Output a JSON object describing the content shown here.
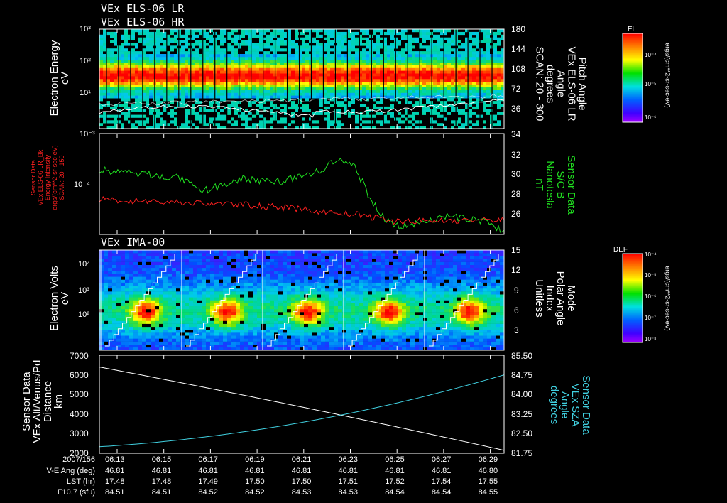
{
  "titles": {
    "p1_line1": "VEx ELS-06 LR",
    "p1_line2": "VEx ELS-06 HR",
    "p3": "VEx IMA-00"
  },
  "colors": {
    "background": "#000000",
    "axis": "#ffffff",
    "red_series": "#ff2020",
    "green_series": "#20e020",
    "sza_series": "#40d0e0",
    "alt_series": "#ffffff"
  },
  "colorbars": {
    "els": {
      "title": "El",
      "ticks": [
        "10⁻⁴",
        "10⁻⁵",
        "10⁻⁶"
      ],
      "unit": "ergs/(cm**2-sr-sec-eV)"
    },
    "ima": {
      "title": "DEF",
      "ticks": [
        "10⁻⁴",
        "10⁻⁵",
        "10⁻⁶",
        "10⁻⁷",
        "10⁻⁸"
      ],
      "unit": "ergs/(cm**2-sr-sec-eV)"
    }
  },
  "chart_data": [
    {
      "type": "heatmap",
      "name_ref": "els_spectrogram",
      "ylabel_lines": [
        "Electron Energy",
        "eV"
      ],
      "yscale": "log",
      "ylim": [
        1,
        1000
      ],
      "yticks": [
        "10⁰",
        "10¹",
        "10²",
        "10³"
      ],
      "right_axis": {
        "label_lines": [
          "Pitch Angle",
          "VEx ELS-06 LR",
          "Angle",
          "degrees",
          "SCAN: 20 - 300"
        ],
        "ylim": [
          0,
          180
        ],
        "ticks": [
          "36",
          "72",
          "108",
          "144",
          "180"
        ]
      },
      "peak_energy_eV": 40
    },
    {
      "type": "line",
      "name_ref": "energy_intensity_and_b",
      "left_axis": {
        "label_lines": [
          "Sensor Data",
          "VEx ELS-06 LR_Bk",
          "Energy Intensity",
          "ergs/(cm**2-sr-sec-eV)",
          "SCAN: 20 - 150"
        ],
        "yscale": "log",
        "ticks": [
          "10⁻³",
          "10⁻⁴"
        ]
      },
      "right_axis": {
        "label_lines": [
          "Sensor Data",
          "S/C B",
          "Nanotesla",
          "nT"
        ],
        "ylim": [
          24.5,
          34
        ],
        "ticks": [
          "26",
          "28",
          "30",
          "32",
          "34"
        ]
      },
      "series": [
        {
          "name": "Energy Intensity",
          "anchors_log10": [
            [
              0,
              -3.95
            ],
            [
              0.35,
              -4.02
            ],
            [
              0.45,
              -4.06
            ],
            [
              0.6,
              -4.15
            ],
            [
              0.65,
              -4.17
            ],
            [
              0.72,
              -4.26
            ],
            [
              1,
              -4.24
            ]
          ]
        },
        {
          "name": "S/C B",
          "anchors_nT": [
            [
              0,
              30.6
            ],
            [
              0.1,
              30.2
            ],
            [
              0.2,
              29.8
            ],
            [
              0.25,
              28.5
            ],
            [
              0.35,
              29.7
            ],
            [
              0.45,
              29.5
            ],
            [
              0.55,
              30.5
            ],
            [
              0.58,
              31.5
            ],
            [
              0.63,
              31.0
            ],
            [
              0.67,
              27.8
            ],
            [
              0.71,
              25.8
            ],
            [
              0.75,
              25.2
            ],
            [
              0.85,
              26.2
            ],
            [
              0.95,
              25.8
            ],
            [
              1,
              24.7
            ]
          ]
        }
      ]
    },
    {
      "type": "heatmap",
      "name_ref": "ima_spectrogram",
      "ylabel_lines": [
        "Electron Volts",
        "eV"
      ],
      "yscale": "log",
      "yticks": [
        "10²",
        "10³",
        "10⁴"
      ],
      "right_axis": {
        "label_lines": [
          "Mode",
          "Polar Angle",
          "Index",
          "Unitless"
        ],
        "ylim": [
          1,
          15
        ],
        "ticks": [
          "3",
          "6",
          "9",
          "12",
          "15"
        ]
      },
      "scan_count": 5
    },
    {
      "type": "line",
      "name_ref": "alt_and_sza",
      "left_axis": {
        "label_lines": [
          "Sensor Data",
          "VEx Alt/Venus/Pd",
          "Distance",
          "km"
        ],
        "ylim": [
          2000,
          7000
        ],
        "ticks": [
          "2000",
          "3000",
          "4000",
          "5000",
          "6000",
          "7000"
        ]
      },
      "right_axis": {
        "label_lines": [
          "Sensor Data",
          "VEx SZA",
          "Angle",
          "degrees"
        ],
        "ylim": [
          81.75,
          85.5
        ],
        "ticks": [
          "81.75",
          "82.50",
          "83.25",
          "84.00",
          "84.75",
          "85.50"
        ]
      },
      "series": [
        {
          "name": "Altitude",
          "start": 6400,
          "end": 2150
        },
        {
          "name": "SZA",
          "start": 82.0,
          "end": 84.75
        }
      ]
    }
  ],
  "time_axis": {
    "row_labels": [
      "2007/156",
      "V-E Ang (deg)",
      "LST (hr)",
      "F10.7 (sfu)"
    ],
    "ticks": [
      "06:13",
      "06:15",
      "06:17",
      "06:19",
      "06:21",
      "06:23",
      "06:25",
      "06:27",
      "06:29"
    ],
    "ve_ang": [
      "46.81",
      "46.81",
      "46.81",
      "46.81",
      "46.81",
      "46.81",
      "46.81",
      "46.81",
      "46.80"
    ],
    "lst": [
      "17.48",
      "17.48",
      "17.49",
      "17.50",
      "17.50",
      "17.51",
      "17.52",
      "17.54",
      "17.55"
    ],
    "f107": [
      "84.51",
      "84.51",
      "84.52",
      "84.52",
      "84.53",
      "84.53",
      "84.54",
      "84.54",
      "84.55"
    ]
  }
}
